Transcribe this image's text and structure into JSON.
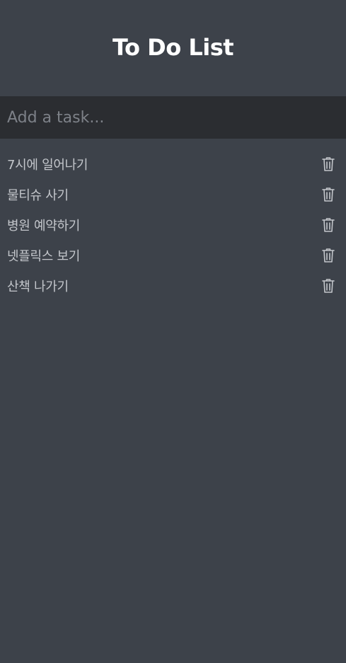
{
  "app": {
    "title": "To Do List"
  },
  "input": {
    "placeholder": "Add a task..."
  },
  "tasks": [
    {
      "text": "7시에 일어나기"
    },
    {
      "text": "물티슈 사기"
    },
    {
      "text": "병원 예약하기"
    },
    {
      "text": "넷플릭스 보기"
    },
    {
      "text": "산책 나가기"
    }
  ],
  "icons": {
    "delete": "trash-icon"
  },
  "colors": {
    "background": "#3d424a",
    "input_background": "#2b2d31",
    "title": "#ffffff",
    "task_text": "#c3c6cb",
    "placeholder": "#7d8188",
    "icon": "#c3c6cb"
  }
}
